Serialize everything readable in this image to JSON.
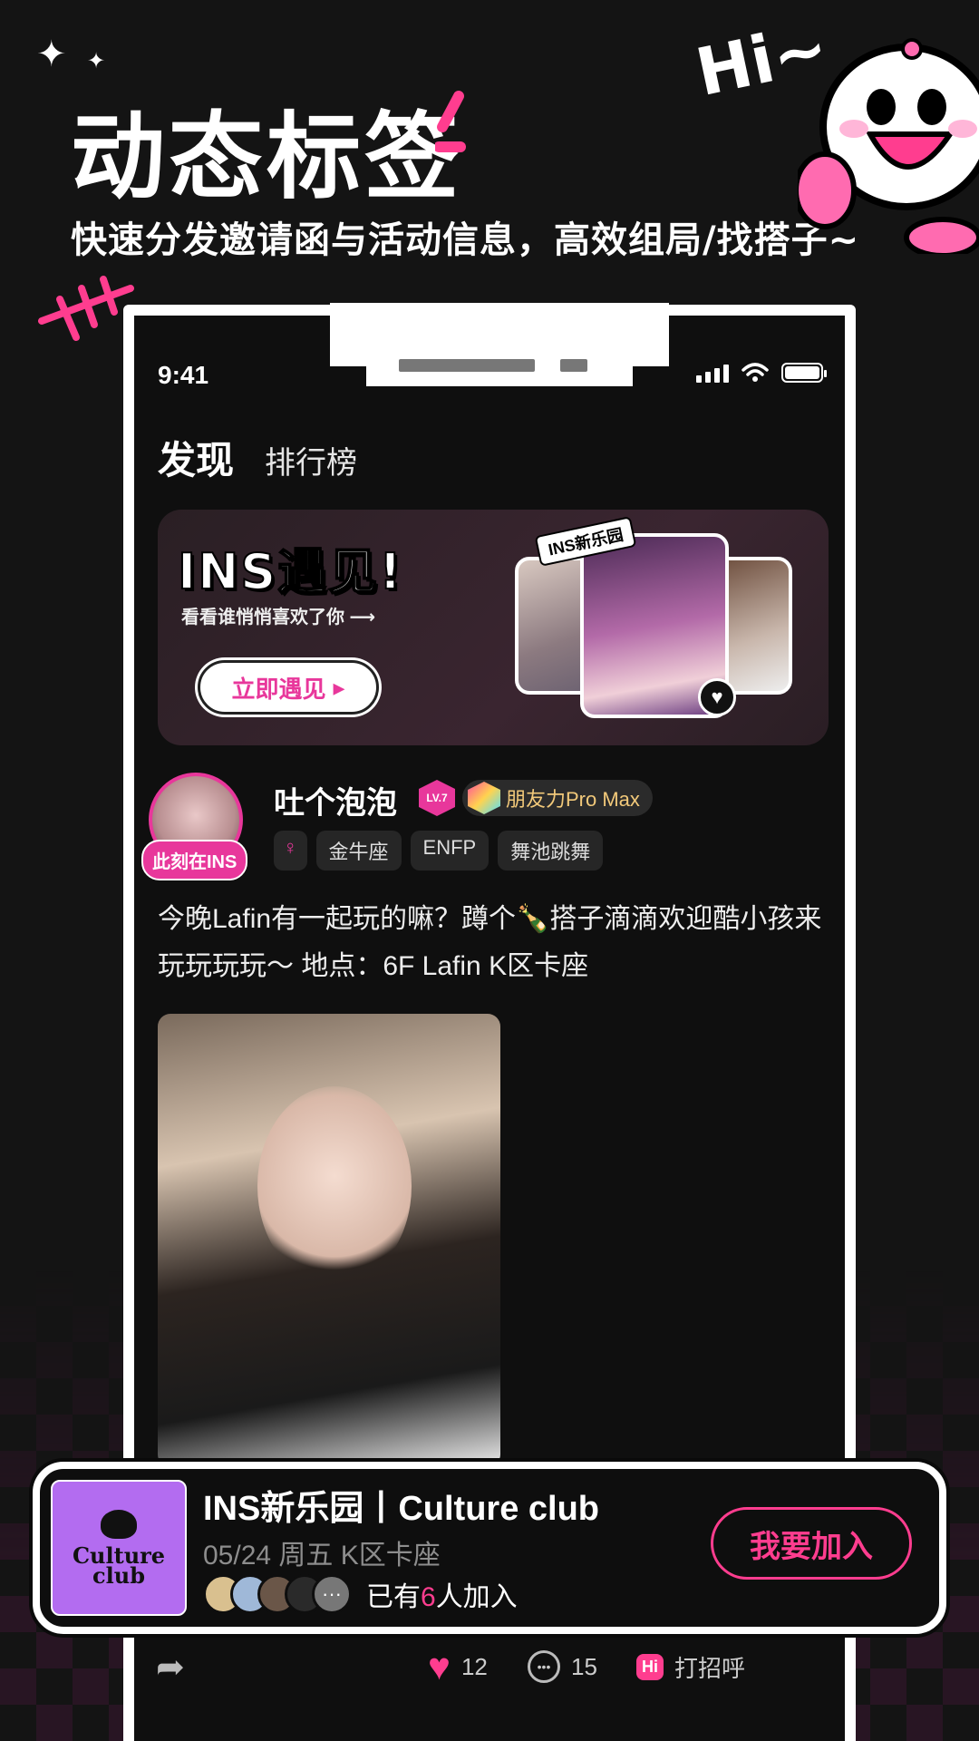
{
  "hero": {
    "title": "动态标签",
    "subtitle": "快速分发邀请函与活动信息，高效组局/找搭子~",
    "hi": "Hi~"
  },
  "status_bar": {
    "time": "9:41"
  },
  "tabs": [
    {
      "label": "发现",
      "active": true
    },
    {
      "label": "排行榜",
      "active": false
    }
  ],
  "banner": {
    "title": "INS遇见!",
    "subtitle": "看看谁悄悄喜欢了你 ⟶",
    "button": "立即遇见",
    "tag": "INS新乐园"
  },
  "post": {
    "user_name": "吐个泡泡",
    "avatar_badge": "此刻在INS",
    "level": "LV.7",
    "friend_power": "朋友力Pro Max",
    "tags": [
      "金牛座",
      "ENFP",
      "舞池跳舞"
    ],
    "text": "今晚Lafin有一起玩的嘛？蹲个🍾搭子滴滴欢迎酷小孩来玩玩玩玩～ 地点：6F Lafin K区卡座",
    "likes": "12",
    "comments": "15",
    "greet_label": "打招呼",
    "greet_icon_text": "Hi"
  },
  "event": {
    "logo_text_1": "Culture",
    "logo_text_2": "club",
    "title": "INS新乐园丨Culture club",
    "date": "05/24 周五 K区卡座",
    "joined_prefix": "已有",
    "joined_count": "6",
    "joined_suffix": "人加入",
    "join_button": "我要加入",
    "more": "···"
  },
  "colors": {
    "accent": "#ff3d8f",
    "pink": "#e8379b",
    "purple": "#b36cf0"
  }
}
